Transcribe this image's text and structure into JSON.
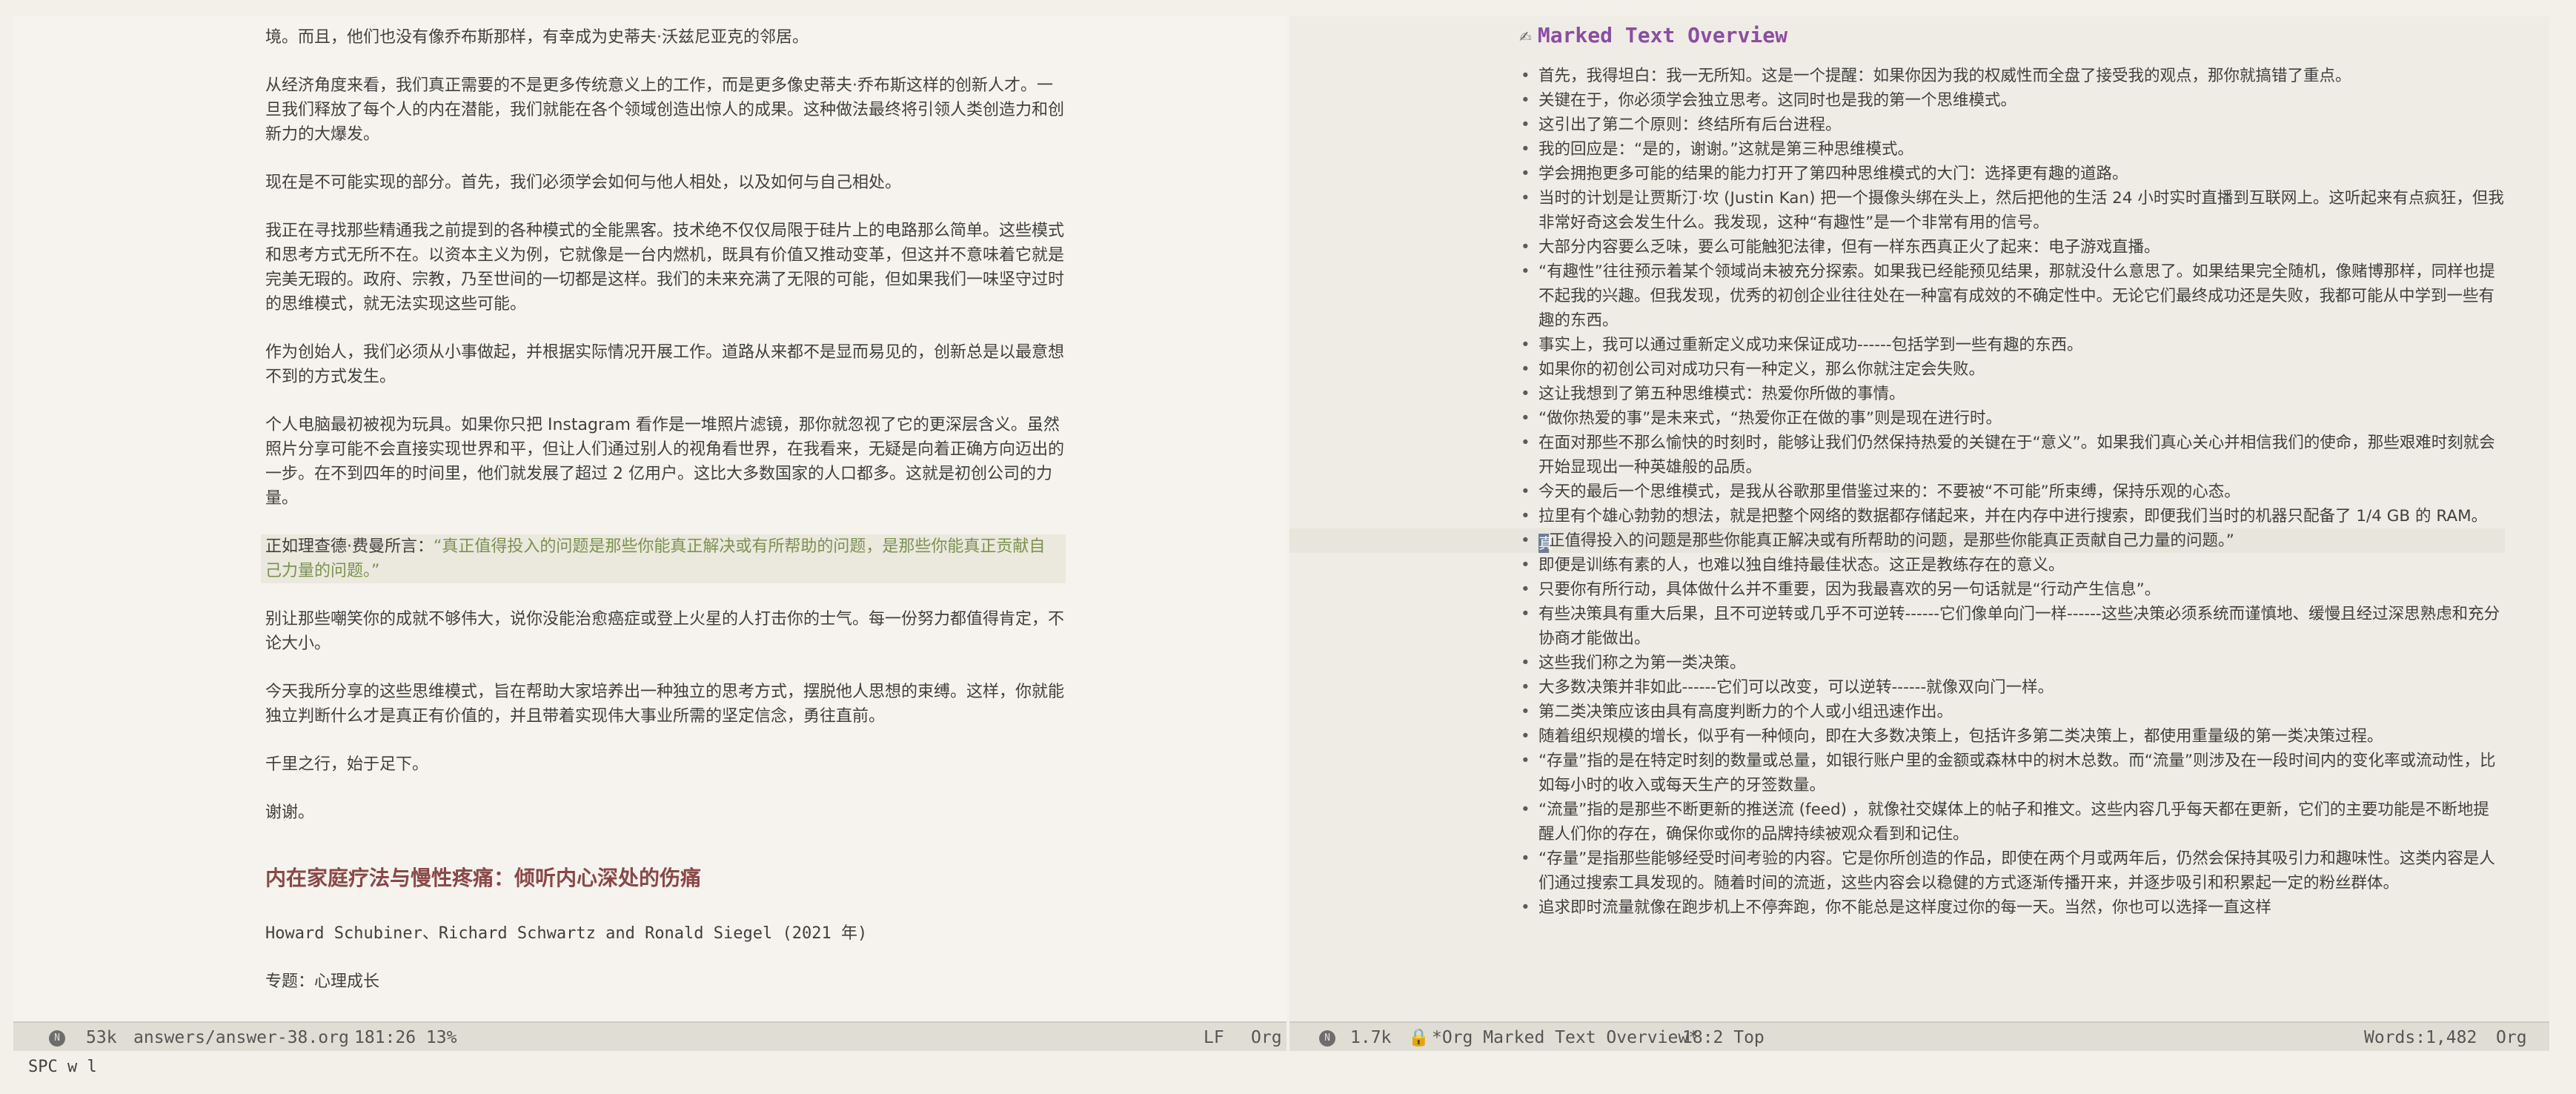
{
  "left_buffer": {
    "paragraphs": [
      "境。而且，他们也没有像乔布斯那样，有幸成为史蒂夫·沃兹尼亚克的邻居。",
      "从经济角度来看，我们真正需要的不是更多传统意义上的工作，而是更多像史蒂夫·乔布斯这样的创新人才。一旦我们释放了每个人的内在潜能，我们就能在各个领域创造出惊人的成果。这种做法最终将引领人类创造力和创新力的大爆发。",
      "现在是不可能实现的部分。首先，我们必须学会如何与他人相处，以及如何与自己相处。",
      "我正在寻找那些精通我之前提到的各种模式的全能黑客。技术绝不仅仅局限于硅片上的电路那么简单。这些模式和思考方式无所不在。以资本主义为例，它就像是一台内燃机，既具有价值又推动变革，但这并不意味着它就是完美无瑕的。政府、宗教，乃至世间的一切都是这样。我们的未来充满了无限的可能，但如果我们一味坚守过时的思维模式，就无法实现这些可能。",
      "作为创始人，我们必须从小事做起，并根据实际情况开展工作。道路从来都不是显而易见的，创新总是以最意想不到的方式发生。",
      "个人电脑最初被视为玩具。如果你只把 Instagram 看作是一堆照片滤镜，那你就忽视了它的更深层含义。虽然照片分享可能不会直接实现世界和平，但让人们通过别人的视角看世界，在我看来，无疑是向着正确方向迈出的一步。在不到四年的时间里，他们就发展了超过 2 亿用户。这比大多数国家的人口都多。这就是初创公司的力量。"
    ],
    "quote_lead": "正如理查德·费曼所言：",
    "quote_text": "“真正值得投入的问题是那些你能真正解决或有所帮助的问题，是那些你能真正贡献自己力量的问题。”",
    "paragraphs_after": [
      "别让那些嘲笑你的成就不够伟大，说你没能治愈癌症或登上火星的人打击你的士气。每一份努力都值得肯定，不论大小。",
      "今天我所分享的这些思维模式，旨在帮助大家培养出一种独立的思考方式，摆脱他人思想的束缚。这样，你就能独立判断什么才是真正有价值的，并且带着实现伟大事业所需的坚定信念，勇往直前。",
      "千里之行，始于足下。",
      "谢谢。"
    ],
    "heading": "内在家庭疗法与慢性疼痛：倾听内心深处的伤痛",
    "authors": "Howard Schubiner、Richard Schwartz and Ronald Siegel (2021 年)",
    "topic": "专题：心理成长"
  },
  "right_buffer": {
    "title_icon": "✍",
    "title": "Marked Text Overview",
    "items": [
      "首先，我得坦白：我一无所知。这是一个提醒：如果你因为我的权威性而全盘了接受我的观点，那你就搞错了重点。",
      "关键在于，你必须学会独立思考。这同时也是我的第一个思维模式。",
      "这引出了第二个原则：终结所有后台进程。",
      "我的回应是：“是的，谢谢。”这就是第三种思维模式。",
      "学会拥抱更多可能的结果的能力打开了第四种思维模式的大门：选择更有趣的道路。",
      "当时的计划是让贾斯汀·坎 (Justin Kan) 把一个摄像头绑在头上，然后把他的生活 24 小时实时直播到互联网上。这听起来有点疯狂，但我非常好奇这会发生什么。我发现，这种“有趣性”是一个非常有用的信号。",
      "大部分内容要么乏味，要么可能触犯法律，但有一样东西真正火了起来：电子游戏直播。",
      "“有趣性”往往预示着某个领域尚未被充分探索。如果我已经能预见结果，那就没什么意思了。如果结果完全随机，像赌博那样，同样也提不起我的兴趣。但我发现，优秀的初创企业往往处在一种富有成效的不确定性中。无论它们最终成功还是失败，我都可能从中学到一些有趣的东西。",
      "事实上，我可以通过重新定义成功来保证成功------包括学到一些有趣的东西。",
      "如果你的初创公司对成功只有一种定义，那么你就注定会失败。",
      "这让我想到了第五种思维模式：热爱你所做的事情。",
      "“做你热爱的事”是未来式，“热爱你正在做的事”则是现在进行时。",
      "在面对那些不那么愉快的时刻时，能够让我们仍然保持热爱的关键在于“意义”。如果我们真心关心并相信我们的使命，那些艰难时刻就会开始显现出一种英雄般的品质。",
      "今天的最后一个思维模式，是我从谷歌那里借鉴过来的：不要被“不可能”所束缚，保持乐观的心态。",
      "拉里有个雄心勃勃的想法，就是把整个网络的数据都存储起来，并在内存中进行搜索，即便我们当时的机器只配备了 1/4 GB 的 RAM。",
      "真正值得投入的问题是那些你能真正解决或有所帮助的问题，是那些你能真正贡献自己力量的问题。”",
      "即便是训练有素的人，也难以独自维持最佳状态。这正是教练存在的意义。",
      "只要你有所行动，具体做什么并不重要，因为我最喜欢的另一句话就是“行动产生信息”。",
      "有些决策具有重大后果，且不可逆转或几乎不可逆转------它们像单向门一样------这些决策必须系统而谨慎地、缓慢且经过深思熟虑和充分协商才能做出。",
      "这些我们称之为第一类决策。",
      "大多数决策并非如此------它们可以改变，可以逆转------就像双向门一样。",
      "第二类决策应该由具有高度判断力的个人或小组迅速作出。",
      "随着组织规模的增长，似乎有一种倾向，即在大多数决策上，包括许多第二类决策上，都使用重量级的第一类决策过程。",
      "“存量”指的是在特定时刻的数量或总量，如银行账户里的金额或森林中的树木总数。而“流量”则涉及在一段时间内的变化率或流动性，比如每小时的收入或每天生产的牙签数量。",
      "“流量”指的是那些不断更新的推送流 (feed) ，就像社交媒体上的帖子和推文。这些内容几乎每天都在更新，它们的主要功能是不断地提醒人们你的存在，确保你或你的品牌持续被观众看到和记住。",
      "“存量”是指那些能够经受时间考验的内容。它是你所创造的作品，即使在两个月或两年后，仍然会保持其吸引力和趣味性。这类内容是人们通过搜索工具发现的。随着时间的流逝，这些内容会以稳健的方式逐渐传播开来，并逐步吸引和积累起一定的粉丝群体。",
      "追求即时流量就像在跑步机上不停奔跑，你不能总是这样度过你的每一天。当然，你也可以选择一直这样"
    ],
    "current_item_index": 15,
    "cursor_char": "真"
  },
  "modeline_left": {
    "state_icon": "N",
    "size": "53k",
    "file": "answers/answer-38.org",
    "position": "181:26 13%",
    "eol": "LF",
    "mode": "Org"
  },
  "modeline_right": {
    "state_icon": "N",
    "size": "1.7k",
    "lock_icon": "🔒",
    "buffer": "*Org Marked Text Overview*",
    "position": "18:2 Top",
    "words": "Words:1,482",
    "mode": "Org"
  },
  "minibuffer": "SPC w l",
  "colors": {
    "background": "#f3f0ea",
    "heading": "#8a4848",
    "quote": "#7a9251",
    "overview_title": "#8a4ea0",
    "modeline": "#e0ddd4",
    "cursor": "#6c7d97"
  }
}
